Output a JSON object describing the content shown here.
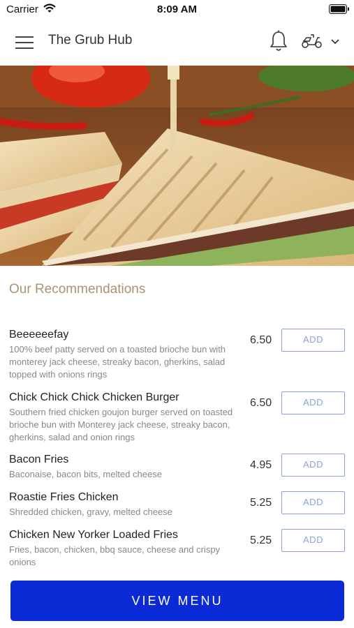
{
  "status_bar": {
    "carrier": "Carrier",
    "time": "8:09 AM"
  },
  "header": {
    "title": "The Grub Hub",
    "icons": [
      "menu-icon",
      "bell-icon",
      "scooter-icon",
      "chevron-down-icon"
    ]
  },
  "section": {
    "title": "Our Recommendations"
  },
  "items": [
    {
      "name": "Beeeeeefay",
      "description": "100% beef patty served on a toasted brioche bun with monterey jack cheese, streaky bacon, gherkins, salad topped with onions rings",
      "price": "6.50",
      "button": "ADD"
    },
    {
      "name": "Chick Chick Chick Chicken Burger",
      "description": "Southern fried chicken goujon burger served on toasted brioche bun with Monterey jack cheese, streaky bacon, gherkins, salad and onion rings",
      "price": "6.50",
      "button": "ADD"
    },
    {
      "name": "Bacon Fries",
      "description": "Baconaise, bacon bits, melted cheese",
      "price": "4.95",
      "button": "ADD"
    },
    {
      "name": "Roastie Fries Chicken",
      "description": "Shredded chicken, gravy, melted cheese",
      "price": "5.25",
      "button": "ADD"
    },
    {
      "name": "Chicken New Yorker Loaded Fries",
      "description": "Fries, bacon, chicken, bbq sauce, cheese and crispy onions",
      "price": "5.25",
      "button": "ADD"
    }
  ],
  "footer": {
    "button": "VIEW MENU"
  },
  "colors": {
    "accent": "#0a2ad6",
    "add_button": "#8aa0d8",
    "section_title": "#a89572"
  }
}
